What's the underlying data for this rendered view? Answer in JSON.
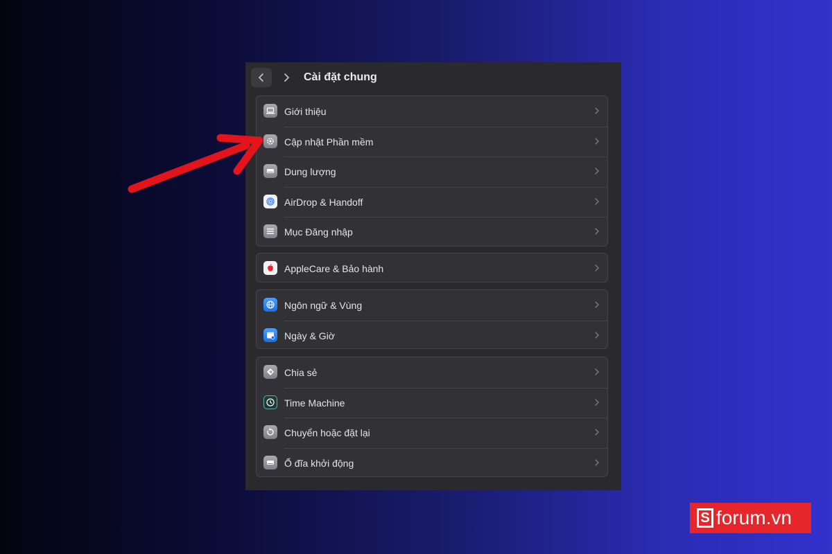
{
  "window": {
    "title": "Cài đặt chung"
  },
  "groups": [
    [
      {
        "label": "Giới thiệu",
        "icon": "laptop-icon"
      },
      {
        "label": "Cập nhật Phần mềm",
        "icon": "gear-icon"
      },
      {
        "label": "Dung lượng",
        "icon": "drive-icon"
      },
      {
        "label": "AirDrop & Handoff",
        "icon": "airdrop-icon"
      },
      {
        "label": "Mục Đăng nhập",
        "icon": "list-icon"
      }
    ],
    [
      {
        "label": "AppleCare & Bảo hành",
        "icon": "apple-icon"
      }
    ],
    [
      {
        "label": "Ngôn ngữ & Vùng",
        "icon": "globe-icon"
      },
      {
        "label": "Ngày & Giờ",
        "icon": "calendar-icon"
      }
    ],
    [
      {
        "label": "Chia sẻ",
        "icon": "share-icon"
      },
      {
        "label": "Time Machine",
        "icon": "time-machine-icon"
      },
      {
        "label": "Chuyển hoặc đặt lại",
        "icon": "reset-icon"
      },
      {
        "label": "Ổ đĩa khởi động",
        "icon": "startup-disk-icon"
      }
    ]
  ],
  "watermark": {
    "badge": "S",
    "text": "forum.vn"
  },
  "colors": {
    "annotation_arrow": "#e3141b",
    "watermark_bg": "#e5262b"
  }
}
